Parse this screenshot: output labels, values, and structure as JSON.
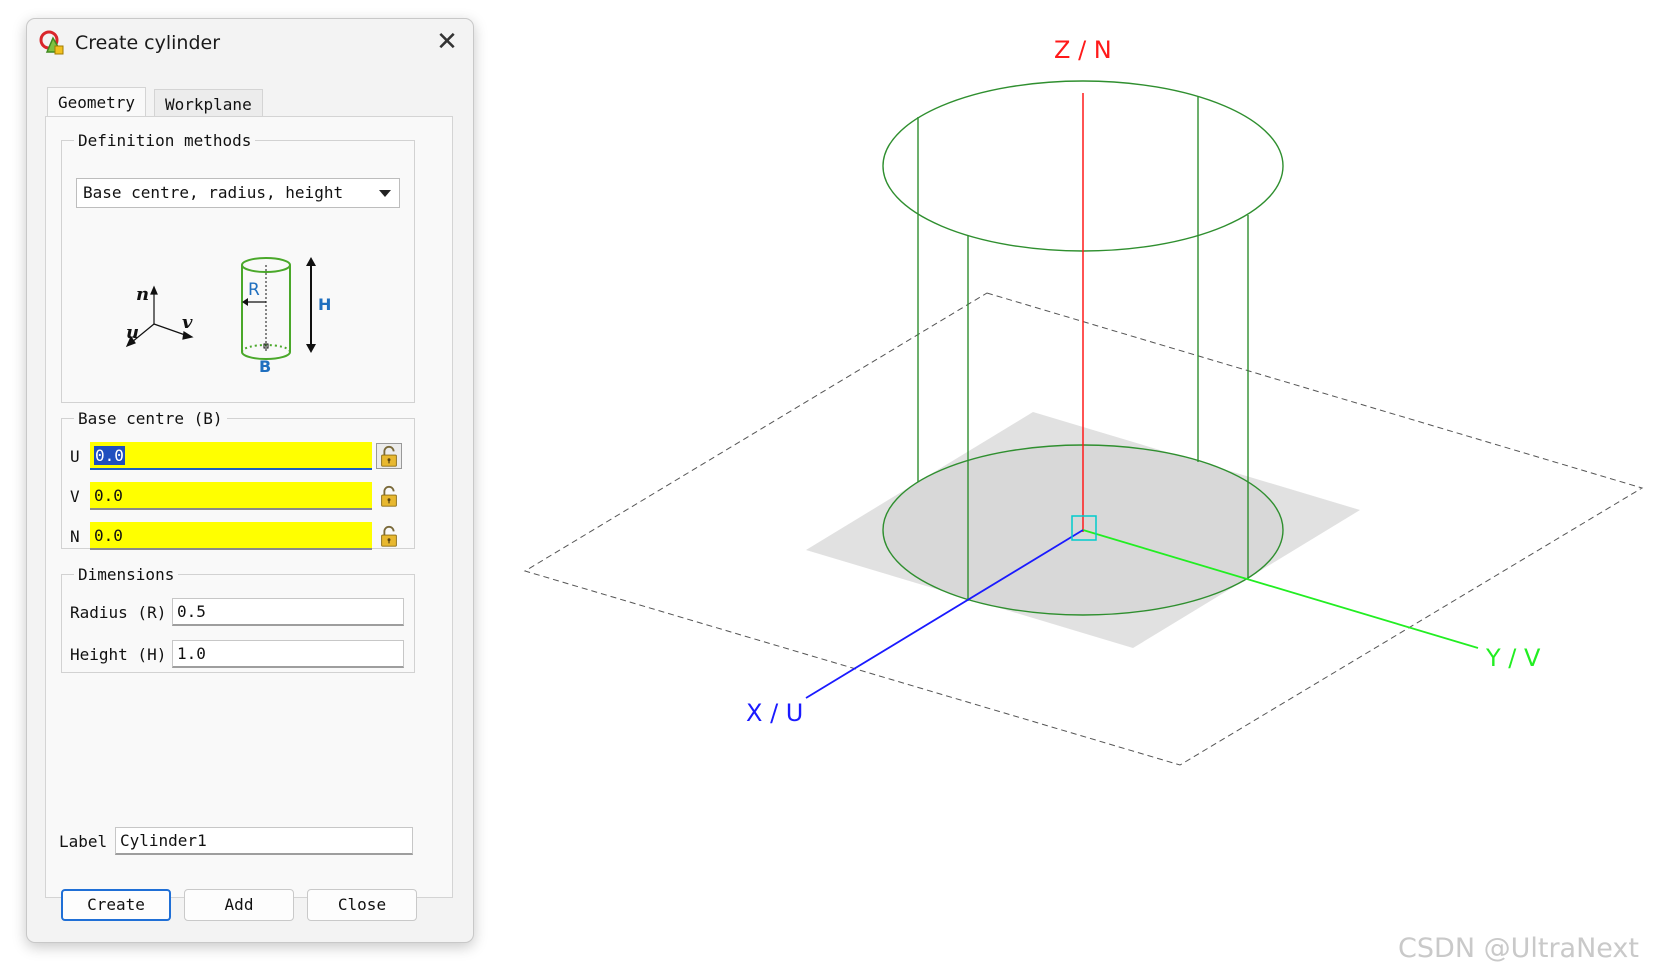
{
  "dialog": {
    "title": "Create cylinder",
    "tabs": [
      {
        "label": "Geometry",
        "active": true
      },
      {
        "label": "Workplane",
        "active": false
      }
    ],
    "definition": {
      "legend": "Definition methods",
      "selected": "Base centre, radius, height",
      "diagram": {
        "n": "n",
        "u": "u",
        "v": "v",
        "r": "R",
        "h": "H",
        "b": "B"
      }
    },
    "base_centre": {
      "legend": "Base centre (B)",
      "fields": [
        {
          "label": "U",
          "value": "0.0",
          "icon": "lock-open-icon"
        },
        {
          "label": "V",
          "value": "0.0",
          "icon": "lock-open-icon"
        },
        {
          "label": "N",
          "value": "0.0",
          "icon": "lock-open-icon"
        }
      ]
    },
    "dimensions": {
      "legend": "Dimensions",
      "radius_label": "Radius (R)",
      "radius_value": "0.5",
      "height_label": "Height (H)",
      "height_value": "1.0"
    },
    "label": {
      "label": "Label",
      "value": "Cylinder1"
    },
    "buttons": {
      "create": "Create",
      "add": "Add",
      "close": "Close"
    }
  },
  "viewport": {
    "axes": {
      "z": "Z / N",
      "y": "Y / V",
      "x": "X / U"
    },
    "colors": {
      "z": "#ff1a1a",
      "y": "#22ee22",
      "x": "#1a1aff",
      "cylinder": "#2f8f2f",
      "origin": "#00cccc"
    }
  },
  "watermark": "CSDN @UltraNext"
}
